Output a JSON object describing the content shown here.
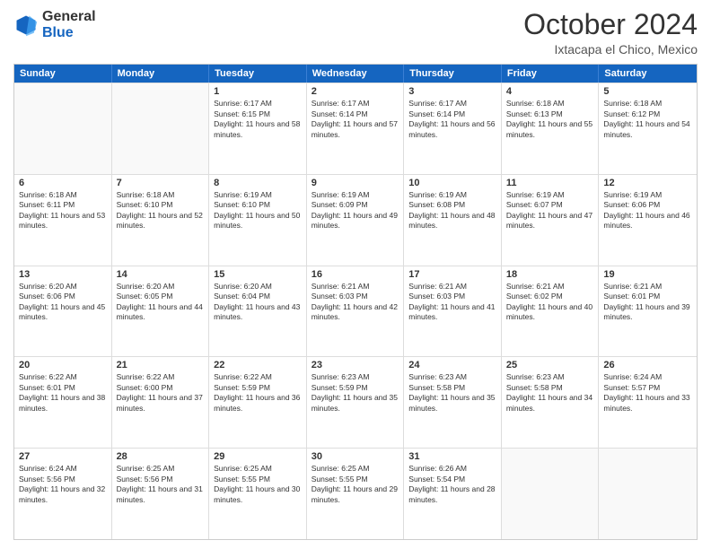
{
  "logo": {
    "general": "General",
    "blue": "Blue"
  },
  "header": {
    "month": "October 2024",
    "location": "Ixtacapa el Chico, Mexico"
  },
  "days": [
    "Sunday",
    "Monday",
    "Tuesday",
    "Wednesday",
    "Thursday",
    "Friday",
    "Saturday"
  ],
  "weeks": [
    [
      {
        "day": "",
        "content": ""
      },
      {
        "day": "",
        "content": ""
      },
      {
        "day": "1",
        "content": "Sunrise: 6:17 AM\nSunset: 6:15 PM\nDaylight: 11 hours and 58 minutes."
      },
      {
        "day": "2",
        "content": "Sunrise: 6:17 AM\nSunset: 6:14 PM\nDaylight: 11 hours and 57 minutes."
      },
      {
        "day": "3",
        "content": "Sunrise: 6:17 AM\nSunset: 6:14 PM\nDaylight: 11 hours and 56 minutes."
      },
      {
        "day": "4",
        "content": "Sunrise: 6:18 AM\nSunset: 6:13 PM\nDaylight: 11 hours and 55 minutes."
      },
      {
        "day": "5",
        "content": "Sunrise: 6:18 AM\nSunset: 6:12 PM\nDaylight: 11 hours and 54 minutes."
      }
    ],
    [
      {
        "day": "6",
        "content": "Sunrise: 6:18 AM\nSunset: 6:11 PM\nDaylight: 11 hours and 53 minutes."
      },
      {
        "day": "7",
        "content": "Sunrise: 6:18 AM\nSunset: 6:10 PM\nDaylight: 11 hours and 52 minutes."
      },
      {
        "day": "8",
        "content": "Sunrise: 6:19 AM\nSunset: 6:10 PM\nDaylight: 11 hours and 50 minutes."
      },
      {
        "day": "9",
        "content": "Sunrise: 6:19 AM\nSunset: 6:09 PM\nDaylight: 11 hours and 49 minutes."
      },
      {
        "day": "10",
        "content": "Sunrise: 6:19 AM\nSunset: 6:08 PM\nDaylight: 11 hours and 48 minutes."
      },
      {
        "day": "11",
        "content": "Sunrise: 6:19 AM\nSunset: 6:07 PM\nDaylight: 11 hours and 47 minutes."
      },
      {
        "day": "12",
        "content": "Sunrise: 6:19 AM\nSunset: 6:06 PM\nDaylight: 11 hours and 46 minutes."
      }
    ],
    [
      {
        "day": "13",
        "content": "Sunrise: 6:20 AM\nSunset: 6:06 PM\nDaylight: 11 hours and 45 minutes."
      },
      {
        "day": "14",
        "content": "Sunrise: 6:20 AM\nSunset: 6:05 PM\nDaylight: 11 hours and 44 minutes."
      },
      {
        "day": "15",
        "content": "Sunrise: 6:20 AM\nSunset: 6:04 PM\nDaylight: 11 hours and 43 minutes."
      },
      {
        "day": "16",
        "content": "Sunrise: 6:21 AM\nSunset: 6:03 PM\nDaylight: 11 hours and 42 minutes."
      },
      {
        "day": "17",
        "content": "Sunrise: 6:21 AM\nSunset: 6:03 PM\nDaylight: 11 hours and 41 minutes."
      },
      {
        "day": "18",
        "content": "Sunrise: 6:21 AM\nSunset: 6:02 PM\nDaylight: 11 hours and 40 minutes."
      },
      {
        "day": "19",
        "content": "Sunrise: 6:21 AM\nSunset: 6:01 PM\nDaylight: 11 hours and 39 minutes."
      }
    ],
    [
      {
        "day": "20",
        "content": "Sunrise: 6:22 AM\nSunset: 6:01 PM\nDaylight: 11 hours and 38 minutes."
      },
      {
        "day": "21",
        "content": "Sunrise: 6:22 AM\nSunset: 6:00 PM\nDaylight: 11 hours and 37 minutes."
      },
      {
        "day": "22",
        "content": "Sunrise: 6:22 AM\nSunset: 5:59 PM\nDaylight: 11 hours and 36 minutes."
      },
      {
        "day": "23",
        "content": "Sunrise: 6:23 AM\nSunset: 5:59 PM\nDaylight: 11 hours and 35 minutes."
      },
      {
        "day": "24",
        "content": "Sunrise: 6:23 AM\nSunset: 5:58 PM\nDaylight: 11 hours and 35 minutes."
      },
      {
        "day": "25",
        "content": "Sunrise: 6:23 AM\nSunset: 5:58 PM\nDaylight: 11 hours and 34 minutes."
      },
      {
        "day": "26",
        "content": "Sunrise: 6:24 AM\nSunset: 5:57 PM\nDaylight: 11 hours and 33 minutes."
      }
    ],
    [
      {
        "day": "27",
        "content": "Sunrise: 6:24 AM\nSunset: 5:56 PM\nDaylight: 11 hours and 32 minutes."
      },
      {
        "day": "28",
        "content": "Sunrise: 6:25 AM\nSunset: 5:56 PM\nDaylight: 11 hours and 31 minutes."
      },
      {
        "day": "29",
        "content": "Sunrise: 6:25 AM\nSunset: 5:55 PM\nDaylight: 11 hours and 30 minutes."
      },
      {
        "day": "30",
        "content": "Sunrise: 6:25 AM\nSunset: 5:55 PM\nDaylight: 11 hours and 29 minutes."
      },
      {
        "day": "31",
        "content": "Sunrise: 6:26 AM\nSunset: 5:54 PM\nDaylight: 11 hours and 28 minutes."
      },
      {
        "day": "",
        "content": ""
      },
      {
        "day": "",
        "content": ""
      }
    ]
  ]
}
